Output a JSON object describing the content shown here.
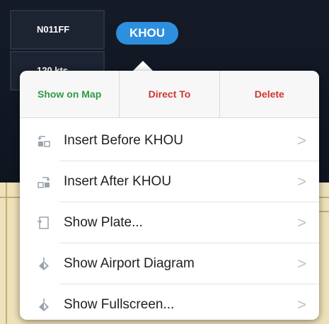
{
  "aircraft": {
    "tail": "N011FF",
    "speed": "120 kts"
  },
  "waypoint": {
    "label": "KHOU"
  },
  "popover": {
    "actions": [
      {
        "label": "Show on Map",
        "color": "#2f9a46"
      },
      {
        "label": "Direct To",
        "color": "#d3342f"
      },
      {
        "label": "Delete",
        "color": "#d3342f"
      }
    ],
    "items": [
      {
        "label": "Insert Before KHOU",
        "icon": "insert-before-icon"
      },
      {
        "label": "Insert After KHOU",
        "icon": "insert-after-icon"
      },
      {
        "label": "Show Plate...",
        "icon": "plate-icon"
      },
      {
        "label": "Show Airport Diagram",
        "icon": "airport-diagram-icon"
      },
      {
        "label": "Show Fullscreen...",
        "icon": "fullscreen-icon"
      }
    ],
    "chevron": ">"
  }
}
